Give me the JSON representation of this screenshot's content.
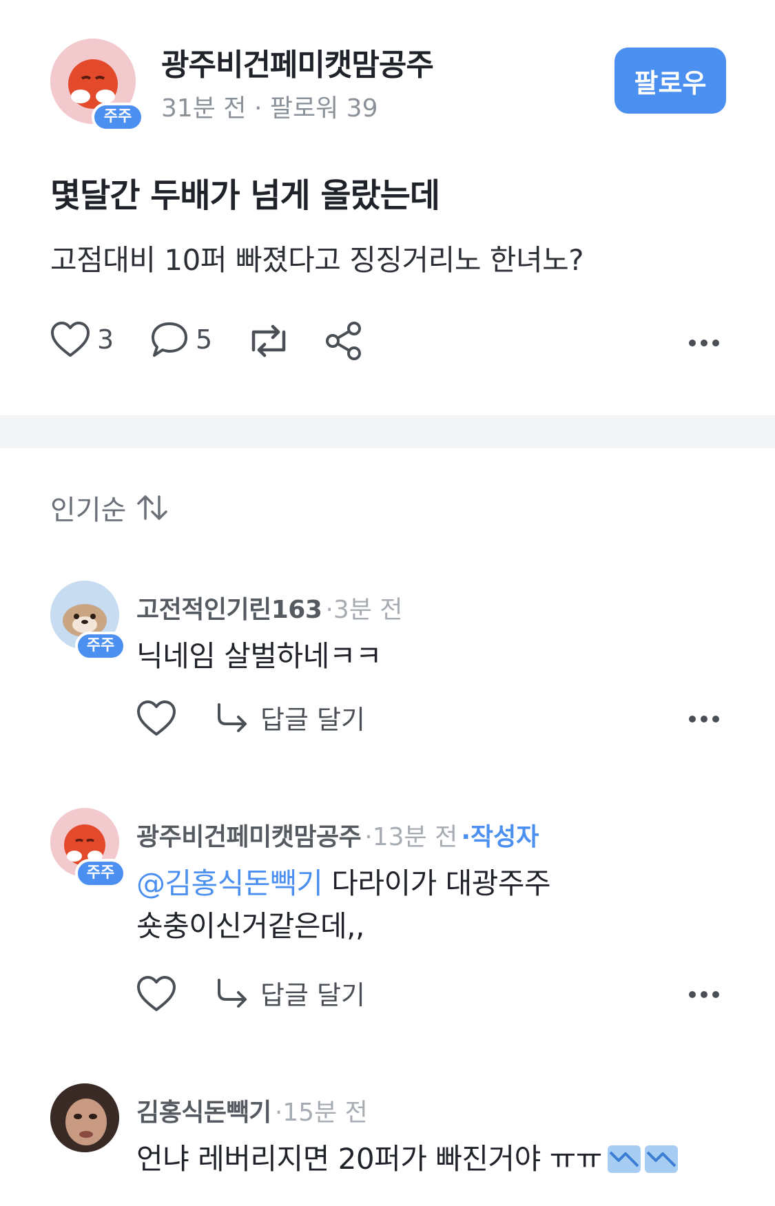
{
  "post": {
    "author": "광주비건페미캣맘공주",
    "holder_badge": "주주",
    "time": "31분 전",
    "separator": "·",
    "followers_label": "팔로워 39",
    "follow_label": "팔로우",
    "title": "몇달간 두배가 넘게 올랐는데",
    "body": "고점대비 10퍼 빠졌다고 징징거리노 한녀노?",
    "like_count": "3",
    "comment_count": "5",
    "icons": [
      "heart-icon",
      "comment-icon",
      "repost-icon",
      "share-icon",
      "more-icon"
    ]
  },
  "sort": {
    "label": "인기순"
  },
  "comments": [
    {
      "name": "고전적인기린163",
      "badge": "주주",
      "time": "·3분 전",
      "text": "닉네임 살벌하네ㅋㅋ",
      "reply_label": "답글 달기"
    },
    {
      "name": "광주비건페미캣맘공주",
      "badge": "주주",
      "time": "·13분 전",
      "author_tag": "·작성자",
      "mention": "@김홍식돈빽기",
      "text_after_mention": " 다라이가 대광주주",
      "text_line2": "숏충이신거같은데,,",
      "reply_label": "답글 달기"
    },
    {
      "name": "김홍식돈빽기",
      "time": "·15분 전",
      "text": "언냐 레버리지면 20퍼가 빠진거야 ㅠㅠ"
    }
  ],
  "colors": {
    "accent": "#4b8ff0",
    "text_primary": "#1f2329",
    "text_muted": "#8b9199",
    "divider": "#f3f4f6"
  }
}
